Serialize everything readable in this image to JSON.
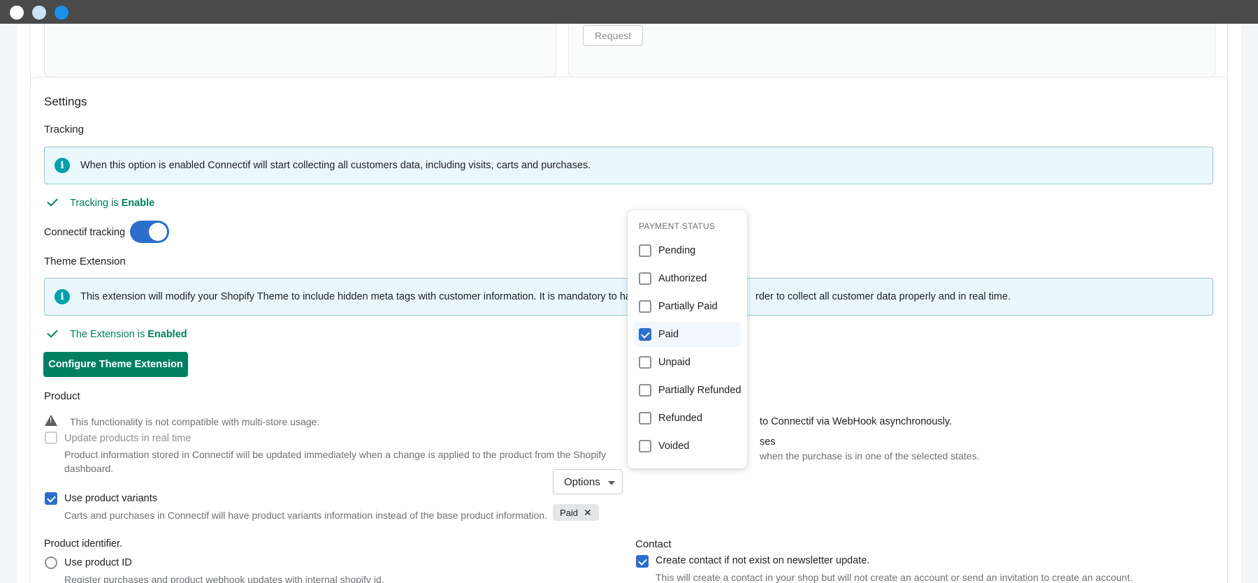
{
  "window": {
    "controls": [
      "close",
      "minimize",
      "maximize"
    ]
  },
  "top_card": {
    "request_label": "Request"
  },
  "settings": {
    "title": "Settings",
    "tracking": {
      "heading": "Tracking",
      "banner": "When this option is enabled Connectif will start collecting all customers data, including visits, carts and purchases.",
      "status_prefix": "Tracking is ",
      "status_value": "Enable",
      "toggle_label": "Connectif tracking",
      "toggle_on": true
    },
    "theme_extension": {
      "heading": "Theme Extension",
      "banner": "This extension will modify your Shopify Theme to include hidden meta tags with customer information. It is mandatory to have",
      "banner_end": "rder to collect all customer data properly and in real time.",
      "status_prefix": "The Extension is ",
      "status_value": "Enabled",
      "button_label": "Configure Theme Extension"
    },
    "product": {
      "heading": "Product",
      "warning": "This functionality is not compatible with multi-store usage.",
      "realtime_label": "Update products in real time",
      "realtime_desc_1": "Product information stored in Connectif will be updated immediately when a change is applied to the product from the Shopify",
      "realtime_desc_2": "dashboard.",
      "variants_label": "Use product variants",
      "variants_desc": "Carts and purchases in Connectif will have product variants information instead of the base product information.",
      "identifier_heading": "Product identifier.",
      "use_id_label": "Use product ID",
      "use_id_desc": "Register purchases and product webhook updates with internal shopify id."
    },
    "purchases": {
      "webhook_text_partial": "to Connectif via WebHook asynchronously.",
      "purchases_label_partial": "ses",
      "states_text_partial": "when the purchase is in one of the selected states.",
      "options_label": "Options",
      "selected_tag": "Paid"
    },
    "contact": {
      "heading": "Contact",
      "create_label": "Create contact if not exist on newsletter update.",
      "create_desc": "This will create a contact in your shop but will not create an account or send an invitation to create an account."
    }
  },
  "popover": {
    "title": "PAYMENT STATUS",
    "items": [
      {
        "label": "Pending",
        "checked": false
      },
      {
        "label": "Authorized",
        "checked": false
      },
      {
        "label": "Partially Paid",
        "checked": false
      },
      {
        "label": "Paid",
        "checked": true
      },
      {
        "label": "Unpaid",
        "checked": false
      },
      {
        "label": "Partially Refunded",
        "checked": false
      },
      {
        "label": "Refunded",
        "checked": false
      },
      {
        "label": "Voided",
        "checked": false
      }
    ]
  },
  "colors": {
    "primary": "#008060",
    "accent": "#2c6ecb",
    "info_bg": "#eaf8fc",
    "info_icon": "#00a0ac"
  }
}
